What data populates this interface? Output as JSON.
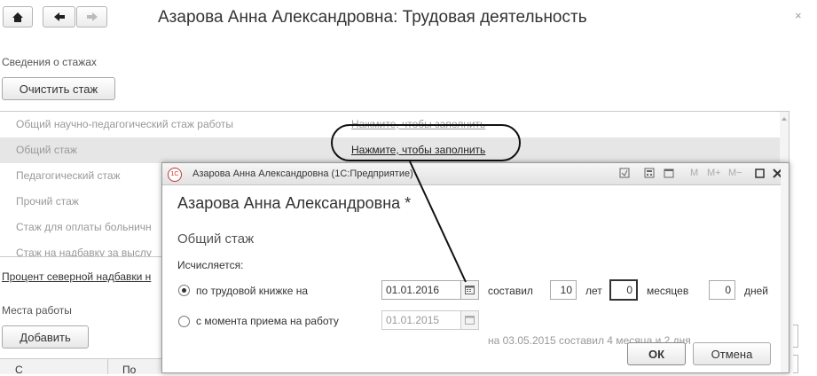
{
  "window": {
    "title": "Азарова Анна Александровна: Трудовая деятельность",
    "close_glyph": "×"
  },
  "nav": {
    "home_icon": "home-icon",
    "back_icon": "arrow-left-icon",
    "forward_icon": "arrow-right-icon"
  },
  "experience": {
    "section_label": "Сведения о стажах",
    "clear_button": "Очистить стаж",
    "rows": [
      {
        "label": "Общий научно-педагогический стаж работы",
        "value": "Нажмите, чтобы заполнить"
      },
      {
        "label": "Общий стаж",
        "value": "Нажмите, чтобы заполнить"
      },
      {
        "label": "Педагогический стаж",
        "value": ""
      },
      {
        "label": "Прочий стаж",
        "value": ""
      },
      {
        "label": "Стаж для оплаты больничн",
        "value": ""
      },
      {
        "label": "Стаж на надбавку за выслу",
        "value": ""
      }
    ],
    "north_link": "Процент северной надбавки н"
  },
  "workplaces": {
    "section_label": "Места работы",
    "add_button": "Добавить",
    "col1": "С",
    "col2": "По"
  },
  "dialog": {
    "header_title": "Азарова Анна Александровна  (1С:Предприятие)",
    "logo_text": "1С",
    "title": "Азарова Анна Александровна *",
    "subtitle": "Общий стаж",
    "calc_label": "Исчисляется:",
    "option1": {
      "label": "по трудовой книжке на",
      "date": "01.01.2016",
      "composed_label": "составил",
      "years": "10",
      "years_label": "лет",
      "months": "0",
      "months_label": "месяцев",
      "days": "0",
      "days_label": "дней"
    },
    "option2": {
      "label": "с момента приема на работу",
      "date": "01.01.2015",
      "note": "на 03.05.2015 составил 4 месяца и 2 дня"
    },
    "ok_button": "ОК",
    "cancel_button": "Отмена",
    "header_icons": {
      "m": "M",
      "mplus": "M+",
      "mminus": "M−",
      "maximize_icon": "maximize-icon",
      "close_icon": "close-icon"
    }
  }
}
